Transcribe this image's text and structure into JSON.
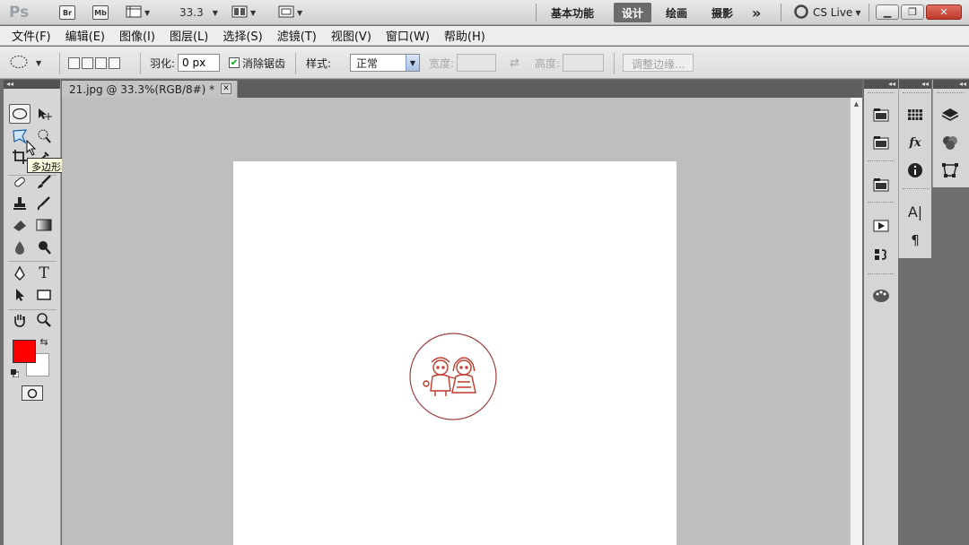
{
  "app": {
    "logo": "Ps",
    "bridge": "Br",
    "mini_bridge": "Mb",
    "zoom": "33.3",
    "workspaces": [
      "基本功能",
      "设计",
      "绘画",
      "摄影"
    ],
    "active_workspace": "设计",
    "more": "»",
    "cslive": "CS Live"
  },
  "menu": [
    "文件(F)",
    "编辑(E)",
    "图像(I)",
    "图层(L)",
    "选择(S)",
    "滤镜(T)",
    "视图(V)",
    "窗口(W)",
    "帮助(H)"
  ],
  "options": {
    "feather_label": "羽化:",
    "feather_value": "0 px",
    "antialias_label": "消除锯齿",
    "antialias_checked": true,
    "style_label": "样式:",
    "style_value": "正常",
    "width_label": "宽度:",
    "height_label": "高度:",
    "refine_edge": "调整边缘..."
  },
  "tooltip": "多边形套索工具 (L)",
  "document": {
    "tab_title": "21.jpg @ 33.3%(RGB/8#) *"
  },
  "colors": {
    "foreground": "#ff0000",
    "background": "#ffffff",
    "stamp": "#c0392b"
  }
}
